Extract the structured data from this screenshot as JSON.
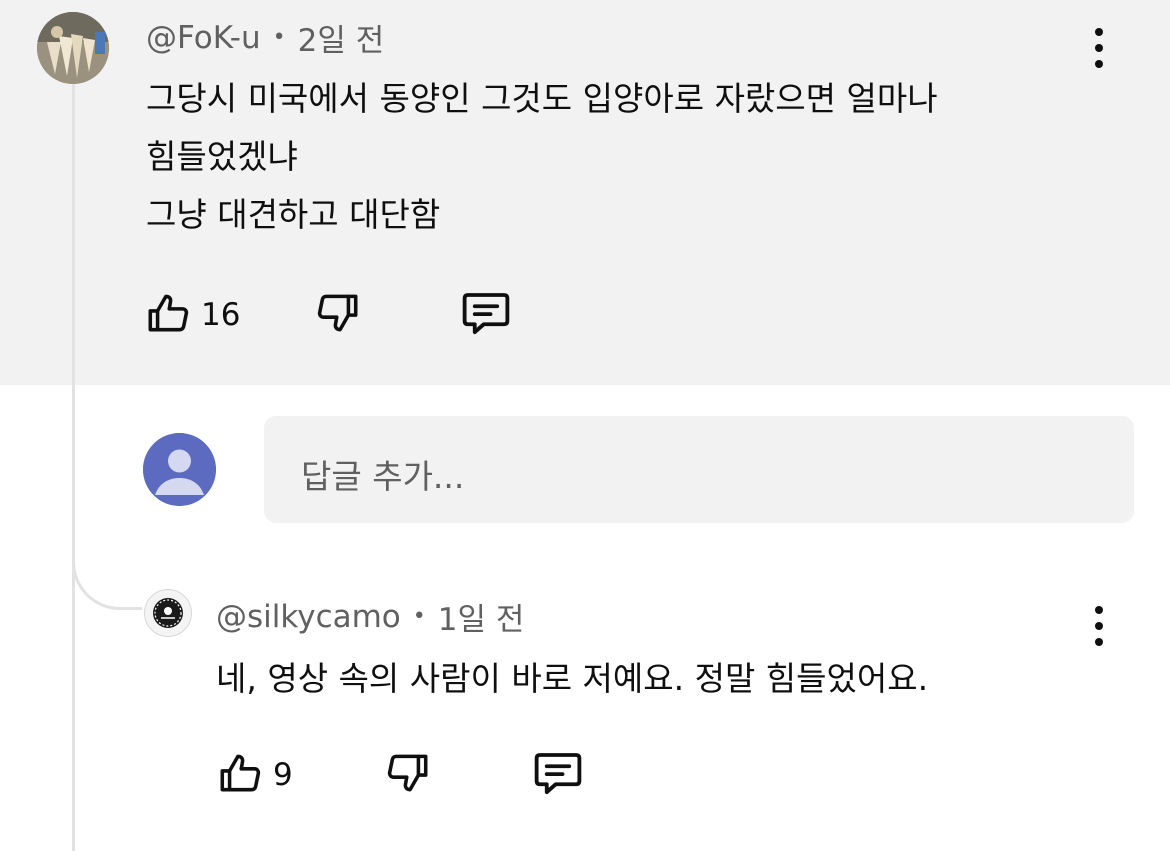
{
  "comment": {
    "author": "@FoK-u",
    "time": "2일 전",
    "lines": [
      "그당시 미국에서 동양인 그것도 입양아로 자랐으면 얼마나",
      "힘들었겠냐",
      "그냥 대견하고 대단함"
    ],
    "likes": "16"
  },
  "reply_input": {
    "placeholder": "답글 추가..."
  },
  "reply": {
    "author": "@silkycamo",
    "time": "1일 전",
    "text": "네, 영상 속의 사람이 바로 저예요. 정말 힘들었어요.",
    "likes": "9"
  },
  "icons": {
    "like": "thumbs-up-icon",
    "dislike": "thumbs-down-icon",
    "reply": "reply-comment-icon",
    "more": "more-vertical-icon"
  },
  "colors": {
    "panel_bg": "#f2f2f2",
    "meta_text": "#606060",
    "avatar_bg": "#5c6bc0"
  }
}
